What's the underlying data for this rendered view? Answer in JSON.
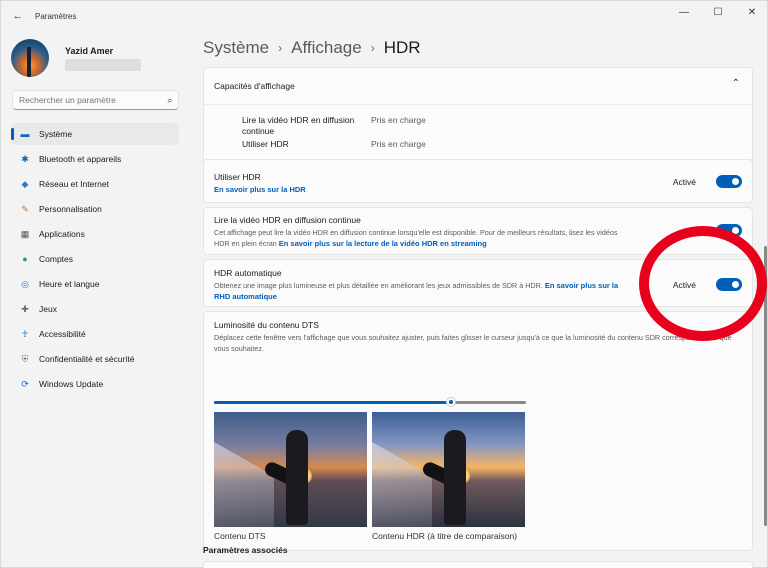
{
  "window": {
    "app_title": "Paramètres",
    "back_icon": "back-arrow-icon",
    "minimize": "—",
    "maximize": "☐",
    "close": "✕"
  },
  "user": {
    "name": "Yazid Amer"
  },
  "search": {
    "placeholder": "Rechercher un paramètre"
  },
  "sidebar": {
    "items": [
      {
        "label": "Système",
        "icon": "system-icon",
        "active": true
      },
      {
        "label": "Bluetooth et appareils",
        "icon": "bluetooth-icon"
      },
      {
        "label": "Réseau et Internet",
        "icon": "wifi-icon"
      },
      {
        "label": "Personnalisation",
        "icon": "brush-icon"
      },
      {
        "label": "Applications",
        "icon": "apps-icon"
      },
      {
        "label": "Comptes",
        "icon": "account-icon"
      },
      {
        "label": "Heure et langue",
        "icon": "globe-clock-icon"
      },
      {
        "label": "Jeux",
        "icon": "gamepad-icon"
      },
      {
        "label": "Accessibilité",
        "icon": "accessibility-icon"
      },
      {
        "label": "Confidentialité et sécurité",
        "icon": "shield-icon"
      },
      {
        "label": "Windows Update",
        "icon": "update-icon"
      }
    ]
  },
  "breadcrumb": {
    "part1": "Système",
    "part2": "Affichage",
    "current": "HDR",
    "sep": "›"
  },
  "capabilities": {
    "title": "Capacités d'affichage",
    "row1_label": "Lire la vidéo HDR en diffusion continue",
    "row1_value": "Pris en charge",
    "row2_label": "Utiliser HDR",
    "row2_value": "Pris en charge"
  },
  "use_hdr": {
    "title": "Utiliser HDR",
    "link": "En savoir plus sur la HDR",
    "state_label": "Activé",
    "on": true
  },
  "streaming": {
    "title": "Lire la vidéo HDR en diffusion continue",
    "desc": "Cet affichage peut lire la vidéo HDR en diffusion continue lorsqu'elle est disponible. Pour de meilleurs résultats, lisez les vidéos HDR en plein écran",
    "link": "En savoir plus sur la lecture de la vidéo HDR en streaming",
    "on": true
  },
  "auto_hdr": {
    "title": "HDR automatique",
    "desc": "Obtenez une image plus lumineuse et plus détaillée en améliorant les jeux admissibles de SDR à HDR.",
    "link": "En savoir plus sur la RHD automatique",
    "state_label": "Activé",
    "on": true
  },
  "sdr_brightness": {
    "title": "Luminosité du contenu DTS",
    "desc": "Déplacez cette fenêtre vers l'affichage que vous souhaitez ajuster, puis faites glisser le curseur jusqu'à ce que la luminosité du contenu SDR corresponde à ce que vous souhaitez.",
    "slider_value_fraction": 0.76,
    "preview_left_label": "Contenu DTS",
    "preview_right_label": "Contenu HDR (à titre de comparaison)"
  },
  "related": {
    "title": "Paramètres associés"
  },
  "colors": {
    "accent": "#005fb8",
    "annotation_circle": "#e8001c"
  }
}
